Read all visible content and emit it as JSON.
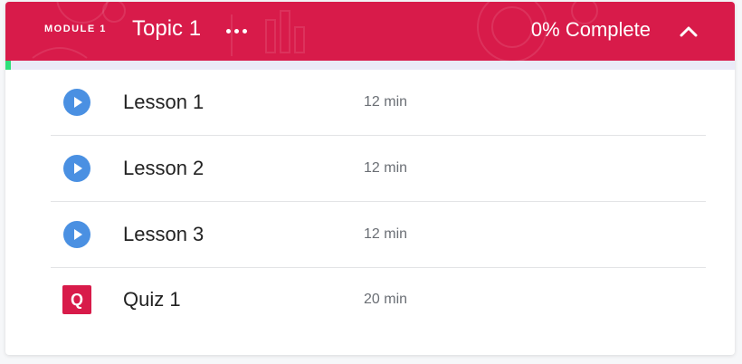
{
  "header": {
    "module_label": "MODULE 1",
    "topic_title": "Topic 1",
    "completion_text": "0% Complete",
    "background_color": "#d81b4a"
  },
  "progress": {
    "percent": 0,
    "fill_color": "#2ee07a",
    "track_color": "#eaeaf7"
  },
  "items": [
    {
      "title": "Lesson 1",
      "duration": "12 min",
      "type": "lesson",
      "icon": "play-icon"
    },
    {
      "title": "Lesson 2",
      "duration": "12 min",
      "type": "lesson",
      "icon": "play-icon"
    },
    {
      "title": "Lesson 3",
      "duration": "12 min",
      "type": "lesson",
      "icon": "play-icon"
    },
    {
      "title": "Quiz 1",
      "duration": "20 min",
      "type": "quiz",
      "icon": "quiz-icon",
      "badge_letter": "Q"
    }
  ],
  "colors": {
    "play_icon": "#4a90e2",
    "quiz_badge": "#d81b4a"
  }
}
